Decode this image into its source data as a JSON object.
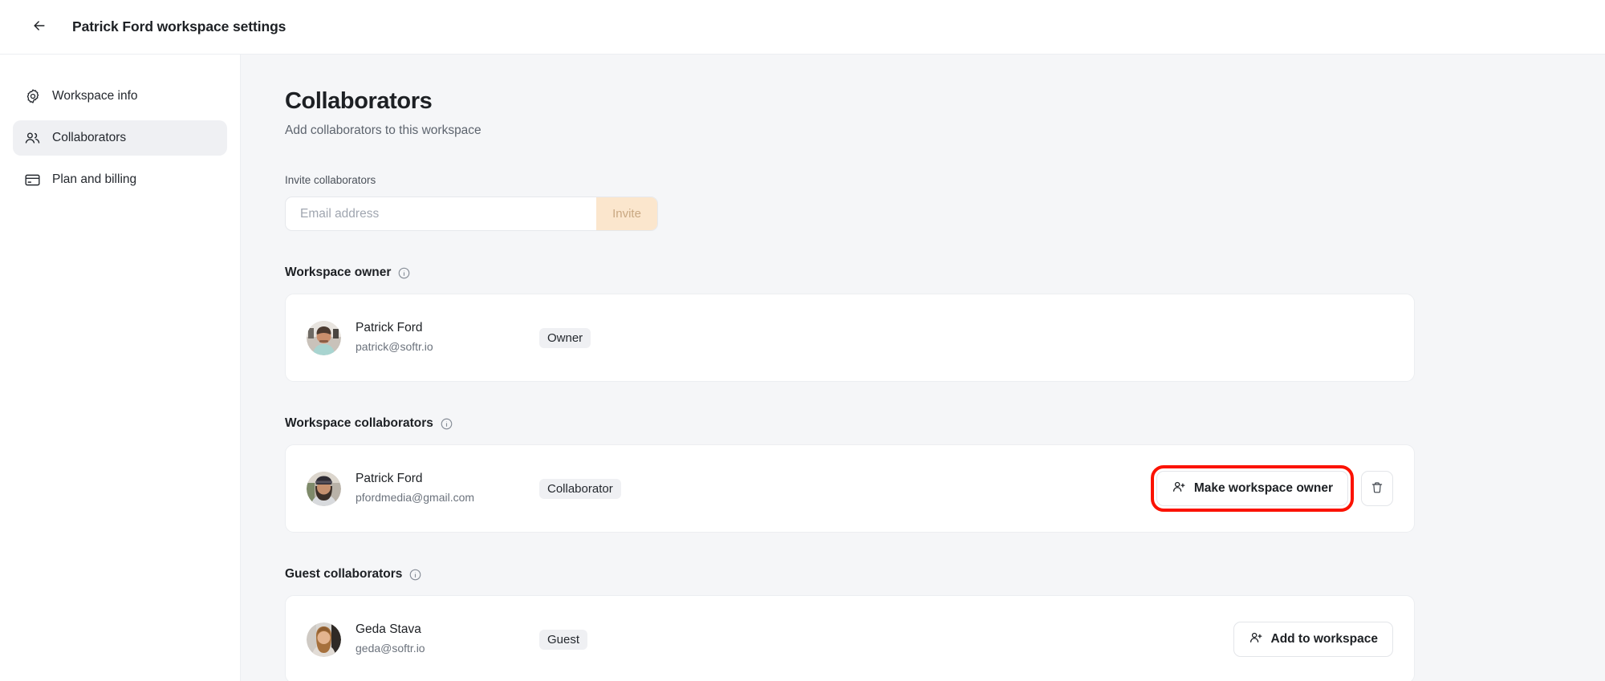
{
  "topbar": {
    "back_icon": "arrow-left-icon",
    "title": "Patrick Ford workspace settings"
  },
  "sidebar": {
    "items": [
      {
        "id": "workspace-info",
        "label": "Workspace info",
        "icon": "gear-icon",
        "active": false
      },
      {
        "id": "collaborators",
        "label": "Collaborators",
        "icon": "users-icon",
        "active": true
      },
      {
        "id": "plan-and-billing",
        "label": "Plan and billing",
        "icon": "credit-card-icon",
        "active": false
      }
    ]
  },
  "main": {
    "title": "Collaborators",
    "subtitle": "Add collaborators to this workspace",
    "invite": {
      "label": "Invite collaborators",
      "placeholder": "Email address",
      "value": "",
      "button_label": "Invite",
      "button_bg": "#fbe6cd",
      "button_text_color": "#c9a882"
    },
    "sections": [
      {
        "id": "workspace-owner",
        "title": "Workspace owner",
        "info_icon": "info-icon",
        "rows": [
          {
            "name": "Patrick Ford",
            "email": "patrick@softr.io",
            "badge": "Owner",
            "avatar": "avatar-patrick-owner",
            "actions": []
          }
        ]
      },
      {
        "id": "workspace-collaborators",
        "title": "Workspace collaborators",
        "info_icon": "info-icon",
        "rows": [
          {
            "name": "Patrick Ford",
            "email": "pfordmedia@gmail.com",
            "badge": "Collaborator",
            "avatar": "avatar-patrick-collaborator",
            "actions": [
              {
                "id": "make-workspace-owner",
                "label": "Make workspace owner",
                "icon": "user-plus-icon",
                "highlighted": true
              },
              {
                "id": "delete-collaborator",
                "label": "",
                "icon": "trash-icon",
                "highlighted": false
              }
            ]
          }
        ]
      },
      {
        "id": "guest-collaborators",
        "title": "Guest collaborators",
        "info_icon": "info-icon",
        "rows": [
          {
            "name": "Geda Stava",
            "email": "geda@softr.io",
            "badge": "Guest",
            "avatar": "avatar-geda",
            "actions": [
              {
                "id": "add-to-workspace",
                "label": "Add to workspace",
                "icon": "user-plus-icon",
                "highlighted": false
              }
            ]
          }
        ]
      }
    ]
  },
  "annotation": {
    "highlight_color": "#fb1200",
    "target": "make-workspace-owner"
  }
}
